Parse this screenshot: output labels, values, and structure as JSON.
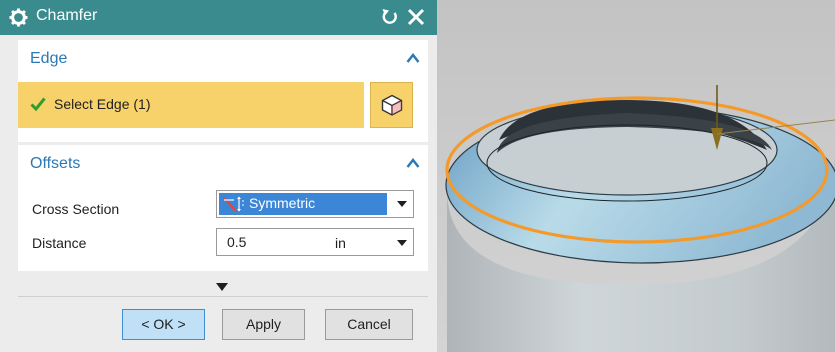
{
  "dialog": {
    "title": "Chamfer",
    "edge_group": {
      "title": "Edge",
      "select_label": "Select Edge (1)"
    },
    "offsets_group": {
      "title": "Offsets",
      "cross_section_label": "Cross Section",
      "cross_section_value": "Symmetric",
      "distance_label": "Distance",
      "distance_value": "0.5",
      "distance_unit": "in"
    },
    "buttons": {
      "ok": "< OK >",
      "apply": "Apply",
      "cancel": "Cancel"
    }
  },
  "colors": {
    "titlebar": "#3a8b8e",
    "group_title": "#2a79b6",
    "selection_highlight": "#f7d26b",
    "selected_option": "#3b86d6",
    "edge_highlight": "#f39a2b"
  },
  "icons": [
    "gear-icon",
    "reset-icon",
    "close-icon",
    "chevron-up-icon",
    "checkmark-icon",
    "cube-icon",
    "symmetric-icon",
    "dropdown-arrow-icon",
    "more-options-arrow-icon"
  ]
}
